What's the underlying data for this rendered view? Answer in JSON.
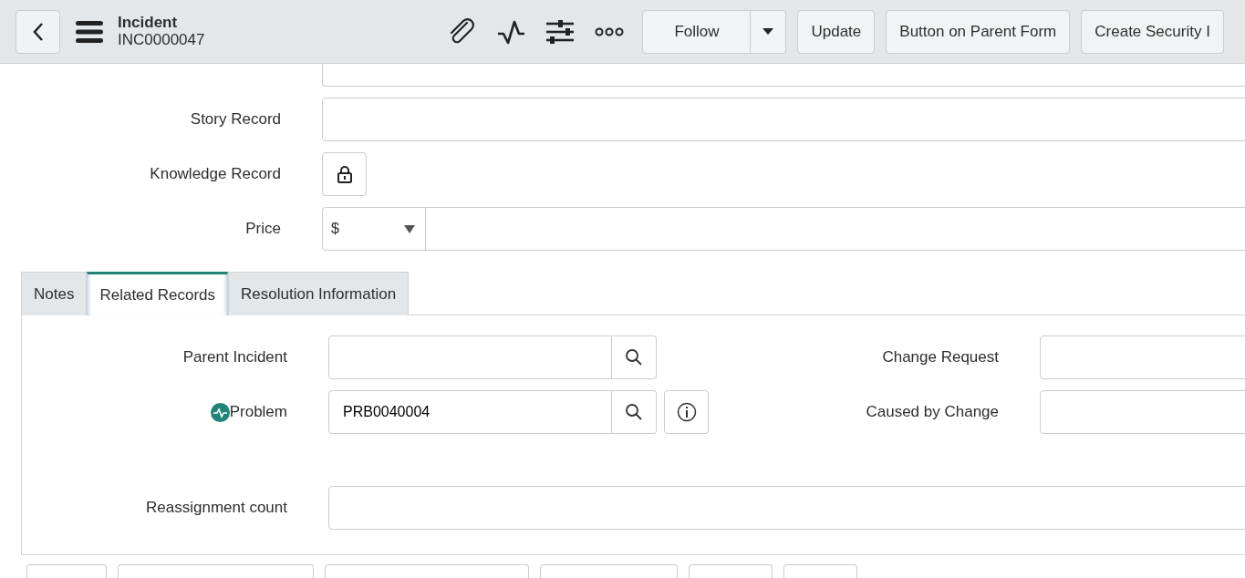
{
  "header": {
    "title": "Incident",
    "number": "INC0000047"
  },
  "header_buttons": [
    {
      "label": "Follow",
      "kind": "split"
    },
    {
      "label": "Update",
      "kind": "plain"
    },
    {
      "label": "Button on Parent Form",
      "kind": "plain"
    },
    {
      "label": "Create Security I",
      "kind": "plain"
    }
  ],
  "fields": [
    {
      "kind": "cut"
    },
    {
      "label": "Story Record",
      "kind": "text"
    },
    {
      "label": "Knowledge Record",
      "kind": "lock"
    },
    {
      "label": "Price",
      "kind": "currency",
      "currency": "$"
    }
  ],
  "tabs": [
    {
      "label": "Notes",
      "selected": false
    },
    {
      "label": "Related Records",
      "selected": true
    },
    {
      "label": "Resolution Information",
      "selected": false
    }
  ],
  "related_left": [
    {
      "label": "Parent Incident",
      "kind": "reference"
    },
    {
      "label": "Problem",
      "kind": "reference_info",
      "value": "PRB0040004"
    }
  ],
  "related_right": [
    {
      "label": "Change Request",
      "kind": "reference"
    },
    {
      "label": "Caused by Change",
      "kind": "reference"
    }
  ],
  "related_bottom": [
    {
      "label": "Reassignment count",
      "kind": "text"
    }
  ],
  "bottom_buttons": [
    {
      "kind": "cut"
    },
    {
      "kind": "cut"
    },
    {
      "kind": "cut"
    },
    {
      "kind": "cut"
    },
    {
      "kind": "cut"
    },
    {
      "kind": "cut"
    }
  ]
}
